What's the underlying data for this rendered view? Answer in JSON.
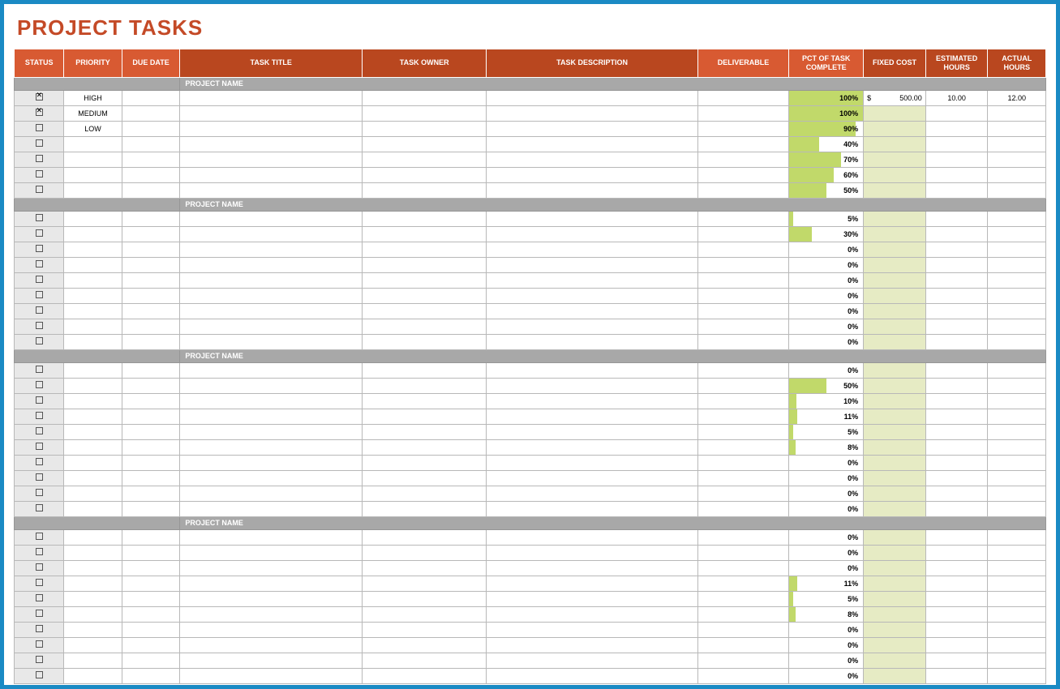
{
  "title": "PROJECT TASKS",
  "columns": {
    "status": "STATUS",
    "priority": "PRIORITY",
    "due_date": "DUE DATE",
    "task_title": "TASK TITLE",
    "task_owner": "TASK OWNER",
    "task_description": "TASK DESCRIPTION",
    "deliverable": "DELIVERABLE",
    "pct_complete": "PCT OF TASK COMPLETE",
    "fixed_cost": "FIXED COST",
    "estimated_hours": "ESTIMATED HOURS",
    "actual_hours": "ACTUAL HOURS"
  },
  "groups": [
    {
      "name": "PROJECT NAME",
      "rows": [
        {
          "checked": true,
          "priority": "HIGH",
          "pct": 100,
          "cost_symbol": "$",
          "cost": "500.00",
          "est": "10.00",
          "act": "12.00"
        },
        {
          "checked": true,
          "priority": "MEDIUM",
          "pct": 100
        },
        {
          "checked": false,
          "priority": "LOW",
          "pct": 90
        },
        {
          "checked": false,
          "priority": "",
          "pct": 40
        },
        {
          "checked": false,
          "priority": "",
          "pct": 70
        },
        {
          "checked": false,
          "priority": "",
          "pct": 60
        },
        {
          "checked": false,
          "priority": "",
          "pct": 50
        }
      ]
    },
    {
      "name": "PROJECT NAME",
      "rows": [
        {
          "checked": false,
          "pct": 5
        },
        {
          "checked": false,
          "pct": 30
        },
        {
          "checked": false,
          "pct": 0
        },
        {
          "checked": false,
          "pct": 0
        },
        {
          "checked": false,
          "pct": 0
        },
        {
          "checked": false,
          "pct": 0
        },
        {
          "checked": false,
          "pct": 0
        },
        {
          "checked": false,
          "pct": 0
        },
        {
          "checked": false,
          "pct": 0
        }
      ]
    },
    {
      "name": "PROJECT NAME",
      "rows": [
        {
          "checked": false,
          "pct": 0
        },
        {
          "checked": false,
          "pct": 50
        },
        {
          "checked": false,
          "pct": 10
        },
        {
          "checked": false,
          "pct": 11
        },
        {
          "checked": false,
          "pct": 5
        },
        {
          "checked": false,
          "pct": 8
        },
        {
          "checked": false,
          "pct": 0
        },
        {
          "checked": false,
          "pct": 0
        },
        {
          "checked": false,
          "pct": 0
        },
        {
          "checked": false,
          "pct": 0
        }
      ]
    },
    {
      "name": "PROJECT NAME",
      "rows": [
        {
          "checked": false,
          "pct": 0
        },
        {
          "checked": false,
          "pct": 0
        },
        {
          "checked": false,
          "pct": 0
        },
        {
          "checked": false,
          "pct": 11
        },
        {
          "checked": false,
          "pct": 5
        },
        {
          "checked": false,
          "pct": 8
        },
        {
          "checked": false,
          "pct": 0
        },
        {
          "checked": false,
          "pct": 0
        },
        {
          "checked": false,
          "pct": 0
        },
        {
          "checked": false,
          "pct": 0
        }
      ]
    }
  ]
}
